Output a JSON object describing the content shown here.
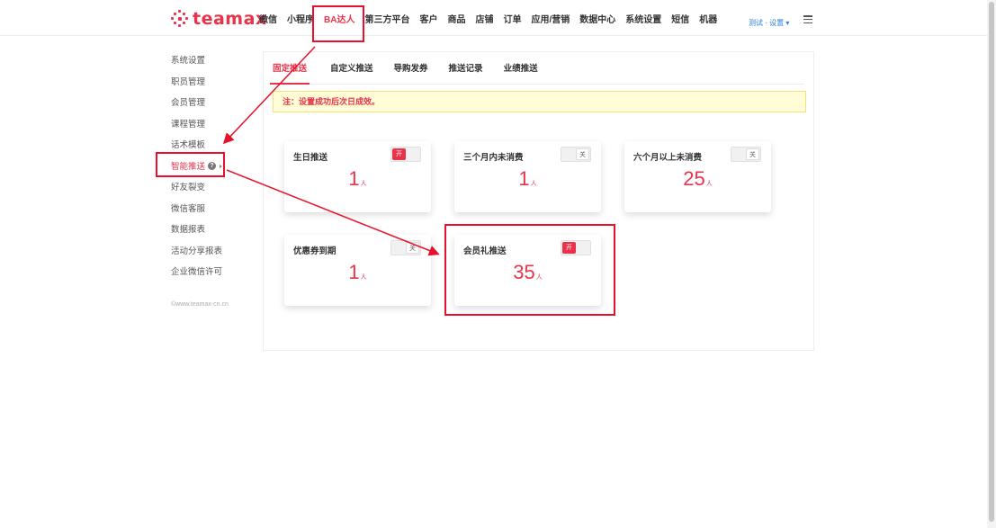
{
  "logo": {
    "text": "teamax"
  },
  "nav": {
    "items": [
      "微信",
      "小程序",
      "BA达人",
      "第三方平台",
      "客户",
      "商品",
      "店铺",
      "订单",
      "应用/营销",
      "数据中心",
      "系统设置",
      "短信",
      "机器"
    ],
    "active": "BA达人",
    "user_label": "测试 · 设置 ▾"
  },
  "sidebar": {
    "items": [
      "系统设置",
      "职员管理",
      "会员管理",
      "课程管理",
      "话术模板",
      "智能推送",
      "好友裂变",
      "微信客服",
      "数据报表",
      "活动分享报表",
      "企业微信许可"
    ],
    "active": "智能推送",
    "copyright": "©www.teamax-cn.cn"
  },
  "tabs": [
    "固定推送",
    "自定义推送",
    "导购发券",
    "推送记录",
    "业绩推送"
  ],
  "active_tab": "固定推送",
  "notice": "注：设置成功后次日成效。",
  "cards": [
    {
      "title": "生日推送",
      "state": "on",
      "toggle_label": "开",
      "value": "1",
      "unit": "人"
    },
    {
      "title": "三个月内未消费",
      "state": "off",
      "toggle_label": "关",
      "value": "1",
      "unit": "人"
    },
    {
      "title": "六个月以上未消费",
      "state": "off",
      "toggle_label": "关",
      "value": "25",
      "unit": "人"
    },
    {
      "title": "优惠券到期",
      "state": "off",
      "toggle_label": "关",
      "value": "1",
      "unit": "人"
    },
    {
      "title": "会员礼推送",
      "state": "on",
      "toggle_label": "开",
      "value": "35",
      "unit": "人"
    }
  ],
  "colors": {
    "accent": "#e8334a",
    "highlight": "#e8102c",
    "notice_bg": "#fffcd6"
  },
  "icons": [
    "logo-sparkle-icon",
    "menu-icon",
    "help-icon",
    "caret-right-icon"
  ]
}
